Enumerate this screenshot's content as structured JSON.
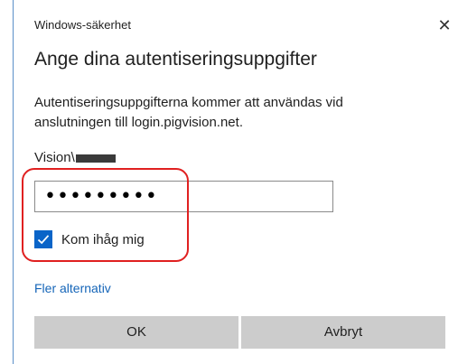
{
  "dialog": {
    "window_title": "Windows-säkerhet",
    "close_glyph": "✕",
    "heading": "Ange dina autentiseringsuppgifter",
    "description": "Autentiseringsuppgifterna kommer att användas vid anslutningen till login.pigvision.net.",
    "username_prefix": "Vision\\",
    "password_value": "•••••••••",
    "remember_label": "Kom ihåg mig",
    "remember_checked": true,
    "more_options_link": "Fler alternativ",
    "ok_label": "OK",
    "cancel_label": "Avbryt"
  },
  "colors": {
    "accent": "#0a64c8",
    "link": "#1565b8",
    "annotation": "#e02020",
    "button_bg": "#cccccc"
  },
  "icons": {
    "close": "close-icon",
    "check": "checkmark-icon"
  }
}
